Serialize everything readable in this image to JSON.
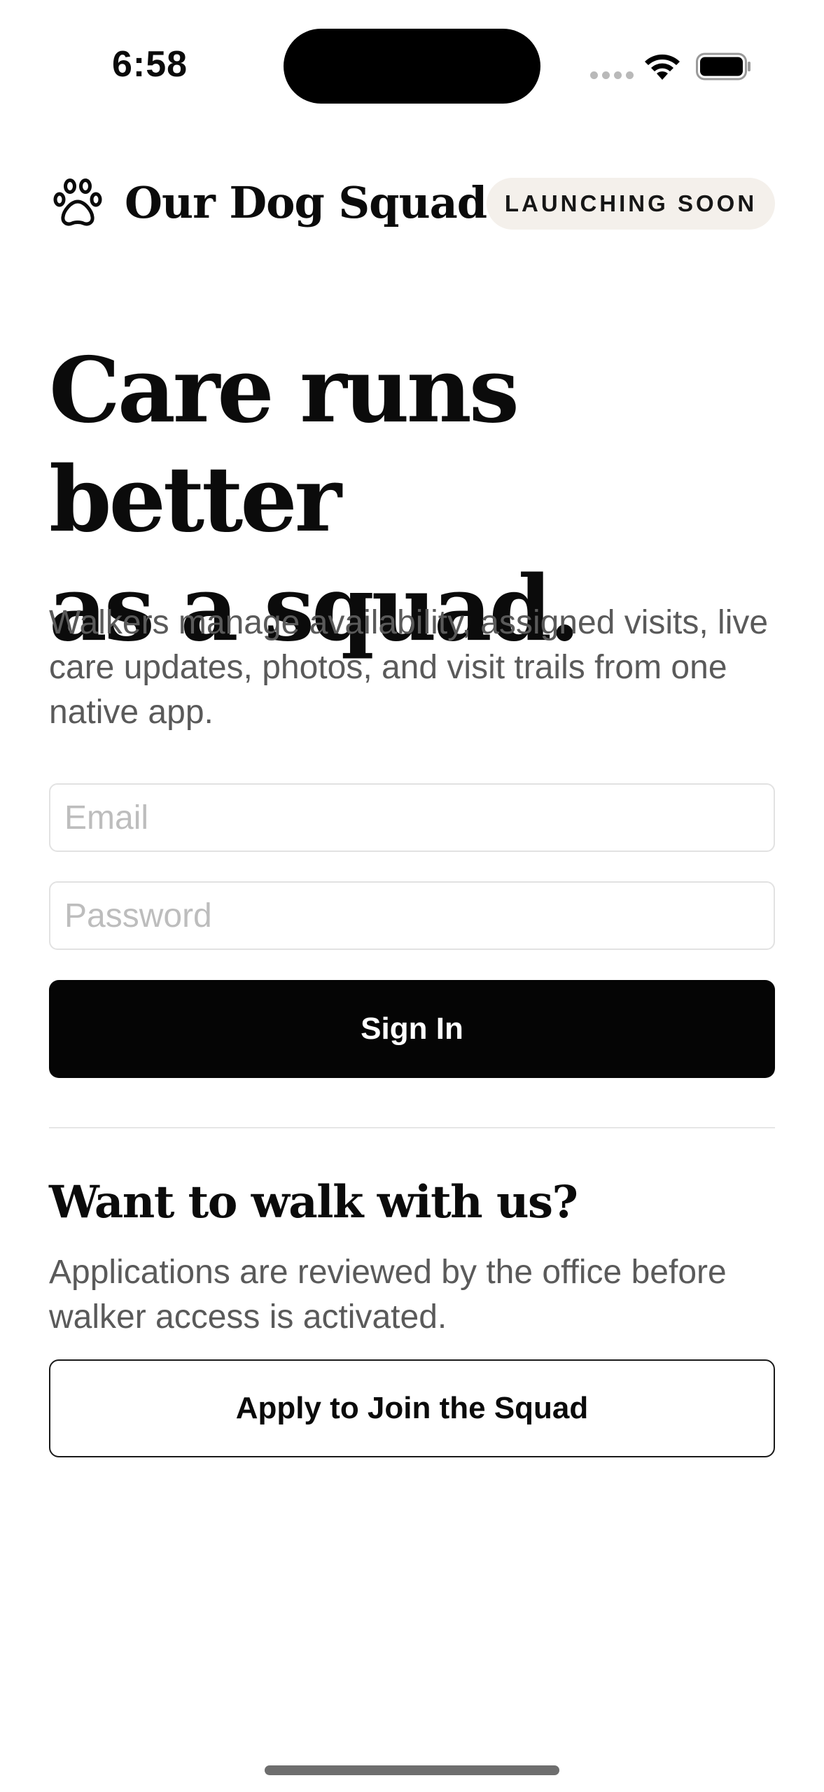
{
  "status_bar": {
    "time": "6:58"
  },
  "header": {
    "brand_name": "Our Dog Squad",
    "badge": "LAUNCHING SOON",
    "logo_icon": "paw-icon"
  },
  "hero": {
    "title_line1": "Care runs better",
    "title_line2": "as a squad.",
    "subtitle": "Walkers manage availability, assigned visits, live care updates, photos, and visit trails from one native app."
  },
  "form": {
    "email_placeholder": "Email",
    "password_placeholder": "Password",
    "sign_in_label": "Sign In"
  },
  "apply": {
    "heading": "Want to walk with us?",
    "text": "Applications are reviewed by the office before walker access is activated.",
    "button_label": "Apply to Join the Squad"
  },
  "colors": {
    "primary": "#050505",
    "badge_bg": "#f4f0eb",
    "muted_text": "#5a5a5a",
    "field_border": "#e2e2e2"
  }
}
